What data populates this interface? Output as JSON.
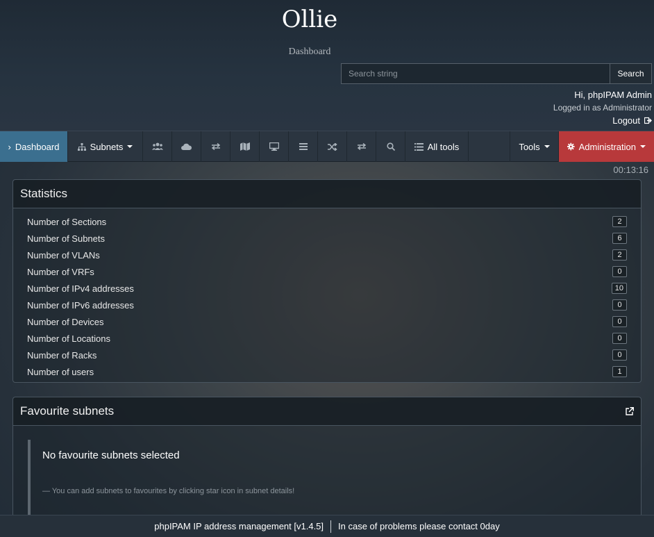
{
  "header": {
    "site_title": "Ollie",
    "site_subtitle": "Dashboard",
    "search_placeholder": "Search string",
    "search_button": "Search",
    "greeting": "Hi, phpIPAM Admin",
    "logged_in_as": "Logged in as  Administrator",
    "logout_label": "Logout"
  },
  "nav": {
    "dashboard_label": "Dashboard",
    "subnets_label": "Subnets",
    "icons": [
      "users-icon",
      "cloud-icon",
      "exchange-icon",
      "map-icon",
      "desktop-icon",
      "list-icon",
      "random-icon",
      "exchange-icon",
      "search-icon"
    ],
    "all_tools_label": "All tools",
    "tools_label": "Tools",
    "admin_label": "Administration"
  },
  "clock": "00:13:16",
  "statistics": {
    "title": "Statistics",
    "rows": [
      {
        "label": "Number of Sections",
        "value": "2"
      },
      {
        "label": "Number of Subnets",
        "value": "6"
      },
      {
        "label": "Number of VLANs",
        "value": "2"
      },
      {
        "label": "Number of VRFs",
        "value": "0"
      },
      {
        "label": "Number of IPv4 addresses",
        "value": "10"
      },
      {
        "label": "Number of IPv6 addresses",
        "value": "0"
      },
      {
        "label": "Number of Devices",
        "value": "0"
      },
      {
        "label": "Number of Locations",
        "value": "0"
      },
      {
        "label": "Number of Racks",
        "value": "0"
      },
      {
        "label": "Number of users",
        "value": "1"
      }
    ]
  },
  "favourites": {
    "title": "Favourite subnets",
    "empty_message": "No favourite subnets selected",
    "hint": "— You can add subnets to favourites by clicking star icon in subnet details!"
  },
  "footer": {
    "app_version": "phpIPAM IP address management [v1.4.5]",
    "contact": "In case of problems please contact 0day"
  },
  "colors": {
    "active_nav": "#3b6f8f",
    "admin_nav": "#b8393b"
  }
}
